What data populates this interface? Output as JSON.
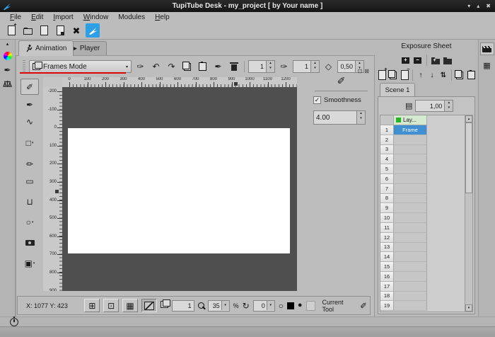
{
  "titlebar": {
    "title": "TupiTube Desk - my_project [ by Your name ]"
  },
  "window_controls": {
    "minimize": "▾",
    "maximize": "▴",
    "close": "✖"
  },
  "menubar": {
    "items": [
      {
        "label": "File",
        "underline": true
      },
      {
        "label": "Edit",
        "underline": true
      },
      {
        "label": "Import",
        "underline": true
      },
      {
        "label": "Window",
        "underline": true
      },
      {
        "label": "Modules",
        "underline": false
      },
      {
        "label": "Help",
        "underline": true
      }
    ]
  },
  "toolbar": {
    "button_names": [
      "new-project",
      "open-project",
      "open-document",
      "save-document",
      "close-project",
      "tupitube-home"
    ]
  },
  "tabs": {
    "animation": "Animation",
    "player": "Player"
  },
  "tool_options": {
    "mode": "Frames Mode",
    "spin1": "1",
    "spin2": "1",
    "spin3": "0,50"
  },
  "tools": [
    {
      "name": "pencil",
      "glyph": "✐",
      "selected": true
    },
    {
      "name": "ink",
      "glyph": "✒"
    },
    {
      "name": "scheme",
      "glyph": "∿"
    },
    {
      "name": "shapes",
      "glyph": "□",
      "dropdown": true,
      "gap": 6
    },
    {
      "name": "pen",
      "glyph": "✏",
      "gap": 6
    },
    {
      "name": "eraser",
      "glyph": "▭"
    },
    {
      "name": "fill",
      "glyph": "⊔",
      "gap": 5
    },
    {
      "name": "tween",
      "glyph": "○",
      "dropdown": true,
      "gap": 5
    },
    {
      "name": "camera",
      "css": true,
      "gap": 5
    },
    {
      "name": "image",
      "glyph": "▣",
      "dropdown": true,
      "gap": 5
    }
  ],
  "rulers": {
    "h": {
      "labels": [
        "0",
        "100",
        "200",
        "300",
        "400",
        "500",
        "600",
        "700",
        "800",
        "900",
        "1000",
        "1100",
        "1200"
      ],
      "origin": 10,
      "step": 25.5
    },
    "v": {
      "labels": [
        "-200",
        "-100",
        "0",
        "100",
        "200",
        "300",
        "400",
        "500",
        "600",
        "700",
        "800",
        "900"
      ],
      "origin": 6,
      "step": 25.6
    }
  },
  "config_panel": {
    "smoothness_label": "Smoothness",
    "smoothness_value": "4.00"
  },
  "status_bar": {
    "position": "X: 1077 Y: 423",
    "frame": "1",
    "zoom": "35",
    "percent": "%",
    "rotation": "0",
    "current_tool": "Current Tool"
  },
  "exposure": {
    "title": "Exposure Sheet",
    "scene_tab": "Scene 1",
    "opacity": "1,00",
    "layer_header": "Lay...",
    "row_count": 19,
    "frames": {
      "1": "Frame"
    }
  },
  "icons": {
    "tupitube-logo": "svg-swoosh",
    "new-project": "css-page-plus",
    "open-project": "css-folder",
    "open-document": "css-page",
    "save-document": "css-page-save",
    "close_project": "✖",
    "play": "▶",
    "dropdown": "▾",
    "spin_up": "▴",
    "spin_down": "▾",
    "undo": "↶",
    "redo": "↷",
    "feather": "✑",
    "pen_down": "✒",
    "diamond": "◇",
    "grid": "⊞",
    "grid_border": "⊡",
    "grid_dense": "▦",
    "rotate": "↻",
    "up": "↑",
    "down": "↓",
    "swap": "⇅",
    "plus": "+",
    "minus": "−",
    "check": "✓",
    "contour_circle": "○",
    "brush_dot": "●",
    "layer_stack": "▤",
    "dock_arrow": "▴",
    "restore_panel": "⊡",
    "close_panel": "⊠",
    "exposure_dock": "▦",
    "pencil_status": "✐"
  },
  "colors": {
    "titlebar": "#1a1a1a",
    "window_bg": "#b9b9b9",
    "canvas_surround": "#4f4f4f",
    "canvas": "#ffffff",
    "accent_blue": "#2d9fe4",
    "selection_blue": "#3f8fd2",
    "layer_green": "#27b427",
    "layer_header_bg": "#d5e9d1",
    "mode_underline_red": "#dd0000"
  }
}
